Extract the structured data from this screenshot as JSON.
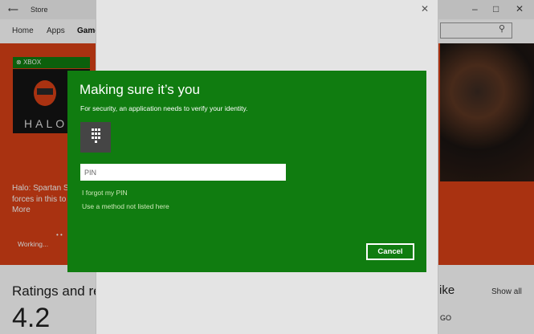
{
  "store": {
    "window_title": "Store",
    "nav": [
      "Home",
      "Apps",
      "Games"
    ],
    "xbox_badge": "XBOX",
    "halo_logo": "HALO",
    "hero_lines": [
      "Halo: Spartan St",
      "forces in this to",
      "More"
    ],
    "working": "Working...",
    "ratings_heading": "Ratings and rev",
    "rating_value": "4.2",
    "like_heading": "ike",
    "show_all": "Show all",
    "go_text": "GO"
  },
  "dialog": {
    "title": "Making sure it’s you",
    "subtitle": "For security, an application needs to verify your identity.",
    "pin_placeholder": "PIN",
    "forgot_link": "I forgot my PIN",
    "other_method_link": "Use a method not listed here",
    "cancel_label": "Cancel"
  },
  "colors": {
    "accent_green": "#107c10",
    "hero_orange": "#d94116"
  },
  "icons": [
    "back-arrow-icon",
    "minimize-icon",
    "maximize-icon",
    "close-icon",
    "search-icon",
    "keypad-icon",
    "xbox-logo-icon"
  ]
}
